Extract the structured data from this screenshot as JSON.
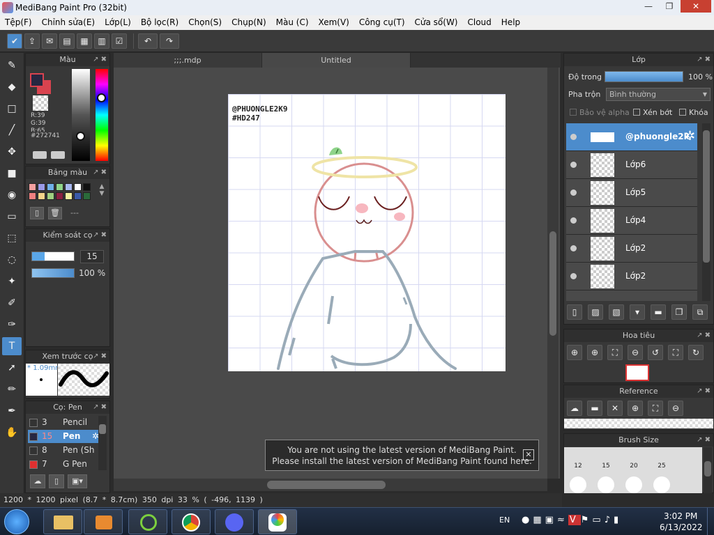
{
  "window": {
    "title": "MediBang Paint Pro (32bit)",
    "min": "—",
    "max": "❐",
    "close": "✕"
  },
  "menu": [
    "Tệp(F)",
    "Chỉnh sửa(E)",
    "Lớp(L)",
    "Bộ lọc(R)",
    "Chọn(S)",
    "Chụp(N)",
    "Màu (C)",
    "Xem(V)",
    "Công cụ(T)",
    "Cửa sổ(W)",
    "Cloud",
    "Help"
  ],
  "tabs": {
    "first": ";;;.mdp",
    "second": "Untitled"
  },
  "color_panel": {
    "title": "Màu",
    "r": "R:39",
    "g": "G:39",
    "b": "B:65",
    "hex": "#272741",
    "primary": "#272741",
    "secondary": "#d9434f"
  },
  "palette_panel": {
    "title": "Bảng màu",
    "name": "---"
  },
  "brush_control": {
    "title": "Kiểm soát cọ",
    "size": "15",
    "opacity": "100 %"
  },
  "brush_preview": {
    "title": "Xem trước cọ",
    "size": "1.09mm"
  },
  "brush_list": {
    "title": "Cọ: Pen",
    "items": [
      {
        "num": "3",
        "name": "Pencil",
        "color": "#333333"
      },
      {
        "num": "15",
        "name": "Pen",
        "color": "#272741"
      },
      {
        "num": "8",
        "name": "Pen (Sh",
        "color": "#333333"
      },
      {
        "num": "7",
        "name": "G Pen",
        "color": "#e03030"
      }
    ]
  },
  "canvas": {
    "watermark_line1": "@PHUONGLE2K9",
    "watermark_line2": "#HD247"
  },
  "notice": {
    "line1": "You are not using the latest version of MediBang Paint.",
    "line2": "Please install the latest version of MediBang Paint found here.",
    "close": "✕"
  },
  "status": {
    "size": "1200 * 1200 pixel",
    "physical": "(8.7 * 8.7cm)",
    "dpi": "350 dpi",
    "zoom": "33 %",
    "coords": "( -496, 1139 )"
  },
  "layers": {
    "title": "Lớp",
    "opacity_label": "Độ trong",
    "opacity_value": "100 %",
    "blend_label": "Pha trộn",
    "blend_value": "Bình thường",
    "protect_alpha": "Bảo vệ alpha",
    "clipping": "Xén bớt",
    "lock": "Khóa",
    "items": [
      "@phuongle2k",
      "Lớp6",
      "Lớp5",
      "Lớp4",
      "Lớp2",
      "Lớp2"
    ]
  },
  "navigator": {
    "title": "Hoa tiêu"
  },
  "reference": {
    "title": "Reference"
  },
  "brush_size": {
    "title": "Brush Size",
    "labels": [
      "12",
      "15",
      "20",
      "25"
    ]
  },
  "taskbar": {
    "lang": "EN",
    "time": "3:02 PM",
    "date": "6/13/2022"
  }
}
